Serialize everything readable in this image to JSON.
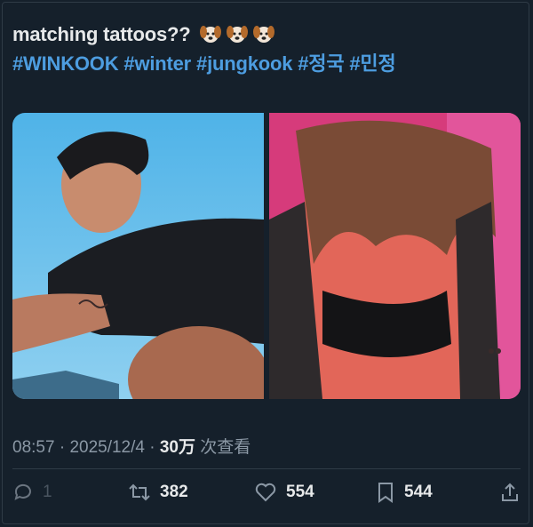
{
  "tweet": {
    "text_line1": "matching tattoos??",
    "emoji": [
      "dog-face-emoji",
      "dog-face-emoji",
      "dog-face-emoji"
    ],
    "hashtags": [
      "#WINKOOK",
      "#winter",
      "#jungkook",
      "#정국",
      "#민정"
    ]
  },
  "meta": {
    "time": "08:57",
    "sep1": "·",
    "date": "2025/12/4",
    "sep2": "·",
    "views_count": "30万",
    "views_label": "次查看"
  },
  "actions": {
    "reply_count": "1",
    "retweet_count": "382",
    "like_count": "554",
    "bookmark_count": "544"
  },
  "colors": {
    "background": "#15202b",
    "hashtag": "#4d9de0",
    "muted": "#8b98a5",
    "text": "#e7e9ea"
  }
}
